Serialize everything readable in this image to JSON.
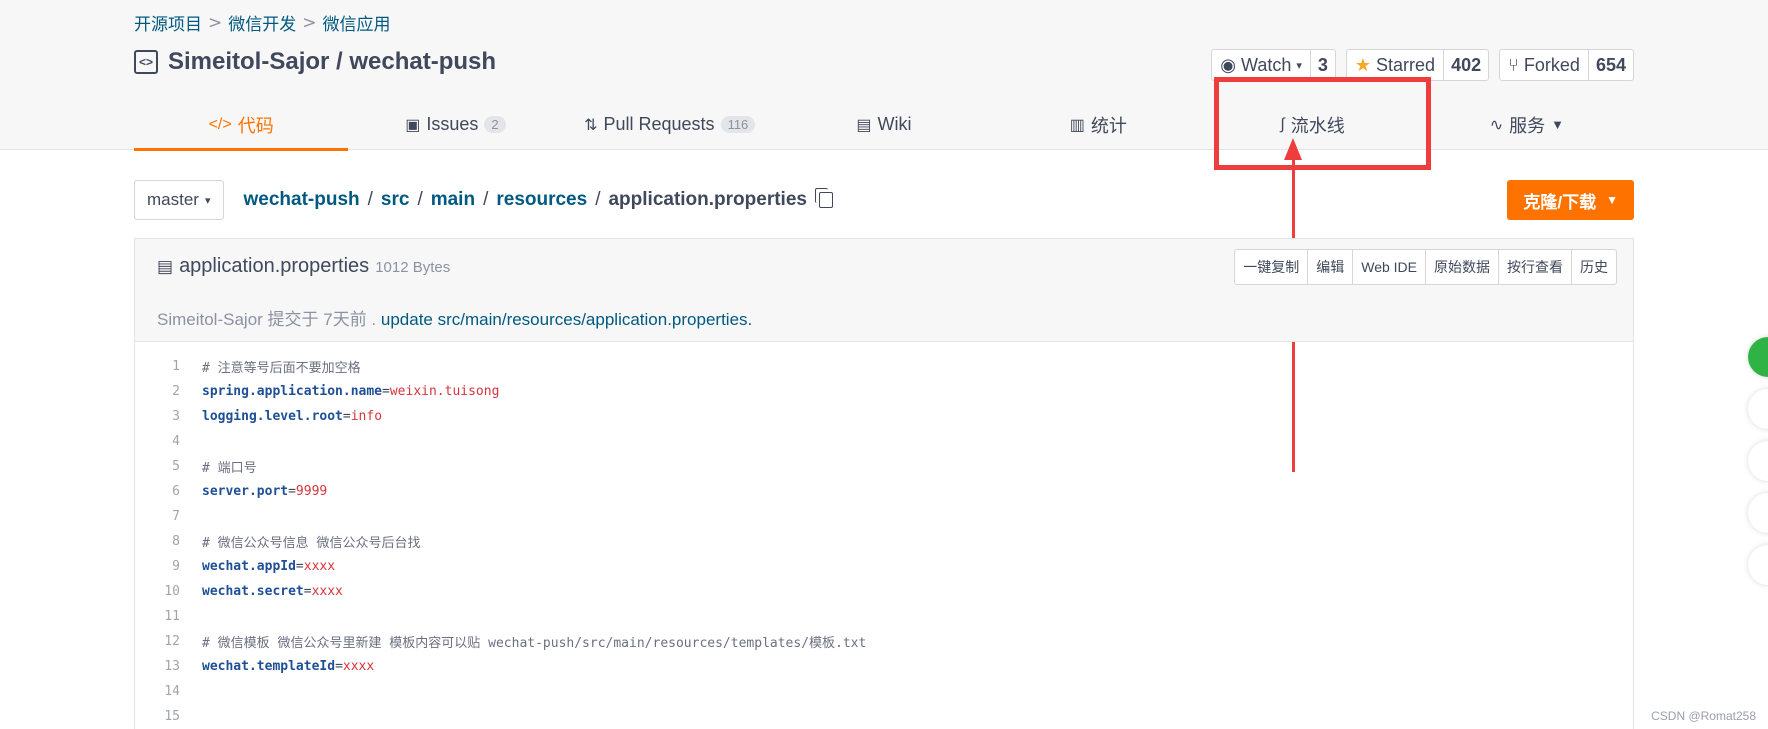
{
  "breadcrumb": [
    "开源项目",
    "微信开发",
    "微信应用"
  ],
  "repo": {
    "title": "Simeitol-Sajor / wechat-push",
    "watch_label": "Watch",
    "watch_count": "3",
    "star_label": "Starred",
    "star_count": "402",
    "fork_label": "Forked",
    "fork_count": "654"
  },
  "tabs": [
    {
      "label": "代码",
      "icon": "code-icon",
      "active": true
    },
    {
      "label": "Issues",
      "badge": "2",
      "icon": "issues-icon"
    },
    {
      "label": "Pull Requests",
      "badge": "116",
      "icon": "pull-request-icon"
    },
    {
      "label": "Wiki",
      "icon": "wiki-icon"
    },
    {
      "label": "统计",
      "icon": "stats-icon"
    },
    {
      "label": "流水线",
      "icon": "pipeline-icon"
    },
    {
      "label": "服务",
      "icon": "service-icon"
    }
  ],
  "branch": {
    "selected": "master"
  },
  "path": {
    "segments": [
      "wechat-push",
      "src",
      "main",
      "resources"
    ],
    "current": "application.properties"
  },
  "clone_button": "克隆/下载",
  "file": {
    "name": "application.properties",
    "size": "1012 Bytes",
    "actions": [
      "一键复制",
      "编辑",
      "Web IDE",
      "原始数据",
      "按行查看",
      "历史"
    ],
    "commit_author": "Simeitol-Sajor",
    "commit_text": " 提交于 7天前 . ",
    "commit_message": "update src/main/resources/application.properties."
  },
  "code_lines": [
    {
      "n": "1",
      "comment": "# 注意等号后面不要加空格"
    },
    {
      "n": "2",
      "key": "spring.application.name",
      "value": "weixin.tuisong"
    },
    {
      "n": "3",
      "key": "logging.level.root",
      "value": "info"
    },
    {
      "n": "4"
    },
    {
      "n": "5",
      "comment": "# 端口号"
    },
    {
      "n": "6",
      "key": "server.port",
      "value": "9999"
    },
    {
      "n": "7"
    },
    {
      "n": "8",
      "comment": "# 微信公众号信息 微信公众号后台找"
    },
    {
      "n": "9",
      "key": "wechat.appId",
      "value": "xxxx"
    },
    {
      "n": "10",
      "key": "wechat.secret",
      "value": "xxxx"
    },
    {
      "n": "11"
    },
    {
      "n": "12",
      "comment": "# 微信模板 微信公众号里新建 模板内容可以贴 wechat-push/src/main/resources/templates/模板.txt"
    },
    {
      "n": "13",
      "key": "wechat.templateId",
      "value": "xxxx"
    },
    {
      "n": "14"
    },
    {
      "n": "15"
    }
  ],
  "watermark": "CSDN @Romat258",
  "colors": {
    "accent": "#fe7300",
    "link": "#005980",
    "annotation": "#ee3d3d"
  }
}
